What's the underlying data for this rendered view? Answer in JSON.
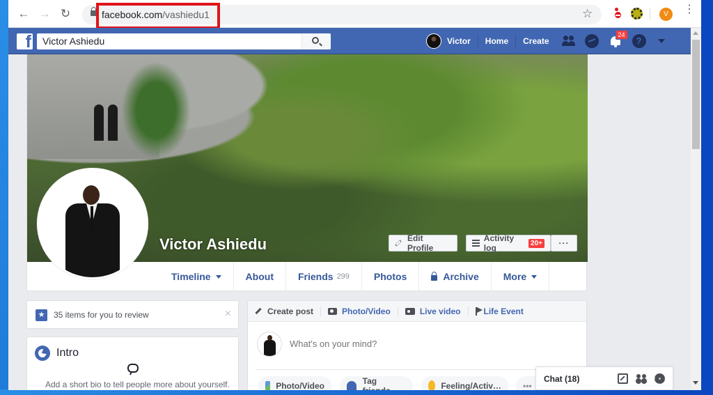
{
  "browser": {
    "url_domain": "facebook.com",
    "url_path": "/vashiedu1",
    "back_icon": "arrow-left",
    "forward_icon": "arrow-right",
    "reload_icon": "reload",
    "bookmark_icon": "star-outline",
    "profile_initial": "V",
    "menu_icon": "vertical-ellipsis"
  },
  "topbar": {
    "search_value": "Victor Ashiedu",
    "user_name": "Victor",
    "home_label": "Home",
    "create_label": "Create",
    "notification_count": "24",
    "help_glyph": "?"
  },
  "profile": {
    "name": "Victor Ashiedu",
    "edit_profile_label": "Edit Profile",
    "activity_log_label": "Activity log",
    "activity_log_badge": "20+",
    "more_options_label": "···"
  },
  "tabs": [
    {
      "label": "Timeline",
      "dropdown": true
    },
    {
      "label": "About"
    },
    {
      "label": "Friends",
      "count": "299"
    },
    {
      "label": "Photos"
    },
    {
      "label": "Archive",
      "locked": true
    },
    {
      "label": "More",
      "dropdown": true
    }
  ],
  "review": {
    "text": "35 items for you to review",
    "close_glyph": "×",
    "star_glyph": "★"
  },
  "intro": {
    "title": "Intro",
    "bio_prompt": "Add a short bio to tell people more about yourself."
  },
  "composer": {
    "tabs": [
      {
        "label": "Create post"
      },
      {
        "label": "Photo/Video"
      },
      {
        "label": "Live video"
      },
      {
        "label": "Life Event"
      }
    ],
    "placeholder": "What's on your mind?",
    "actions": [
      {
        "label": "Photo/Video"
      },
      {
        "label": "Tag friends"
      },
      {
        "label": "Feeling/Activ…"
      },
      {
        "label": "•••"
      }
    ]
  },
  "chat": {
    "label": "Chat (18)"
  }
}
